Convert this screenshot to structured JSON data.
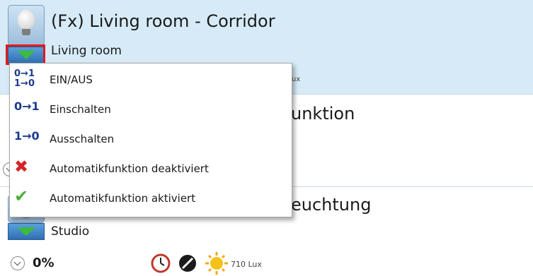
{
  "rows": [
    {
      "title": "(Fx) Living room - Corridor",
      "room": "Living room",
      "lux_fragment": "ux"
    },
    {
      "title_fragment": "unktion"
    },
    {
      "title_fragment": "euchtung",
      "room": "Studio",
      "value": "0%",
      "lux": "710 Lux"
    }
  ],
  "menu": {
    "items": [
      {
        "label": "EIN/AUS",
        "icon": "toggle-on-off-icon"
      },
      {
        "label": "Einschalten",
        "icon": "switch-on-icon"
      },
      {
        "label": "Ausschalten",
        "icon": "switch-off-icon"
      },
      {
        "label": "Automatikfunktion deaktiviert",
        "icon": "red-x-icon"
      },
      {
        "label": "Automatikfunktion aktiviert",
        "icon": "green-check-icon"
      }
    ]
  },
  "glyphs": {
    "on": "0→1",
    "off": "1→0",
    "x": "✖",
    "check": "✔"
  },
  "colors": {
    "row_bg": "#d6ebf7",
    "highlight": "#e21a1a",
    "arrow_green": "#3dbb3d",
    "red_x": "#d42424",
    "check_green": "#4caf3c"
  }
}
